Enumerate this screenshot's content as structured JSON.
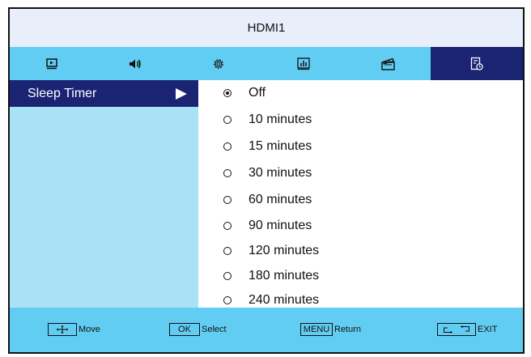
{
  "header": {
    "title": "HDMI1"
  },
  "tabs": [
    {
      "name": "picture",
      "icon": "picture-icon",
      "active": false
    },
    {
      "name": "sound",
      "icon": "speaker-icon",
      "active": false
    },
    {
      "name": "setup",
      "icon": "gear-icon",
      "active": false
    },
    {
      "name": "channel",
      "icon": "equalizer-icon",
      "active": false
    },
    {
      "name": "media",
      "icon": "clapperboard-icon",
      "active": false
    },
    {
      "name": "timer",
      "icon": "timer-icon",
      "active": true
    }
  ],
  "left_menu": {
    "item_label": "Sleep Timer"
  },
  "options": [
    {
      "label": "Off",
      "selected": true
    },
    {
      "label": "10 minutes",
      "selected": false
    },
    {
      "label": "15 minutes",
      "selected": false
    },
    {
      "label": "30 minutes",
      "selected": false
    },
    {
      "label": "60 minutes",
      "selected": false
    },
    {
      "label": "90 minutes",
      "selected": false
    },
    {
      "label": "120 minutes",
      "selected": false
    },
    {
      "label": "180 minutes",
      "selected": false
    },
    {
      "label": "240 minutes",
      "selected": false
    }
  ],
  "footer": {
    "move_label": "Move",
    "ok_key": "OK",
    "select_label": "Select",
    "menu_key": "MENU",
    "return_label": "Return",
    "exit_label": "EXIT"
  },
  "colors": {
    "accent": "#1a2473",
    "tab_bar": "#62cdf3",
    "left_panel": "#a9e2f6"
  }
}
